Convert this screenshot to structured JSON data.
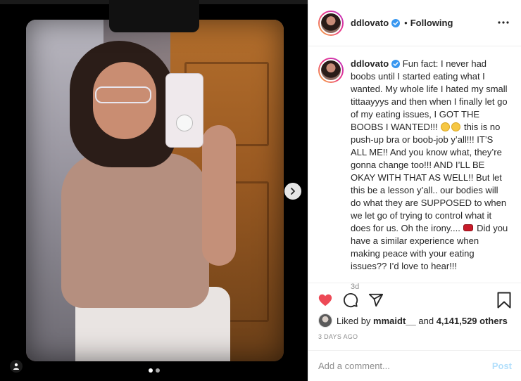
{
  "post": {
    "username": "ddlovato",
    "separator": "•",
    "follow_status": "Following",
    "more_icon": "more-horizontal-icon",
    "verified_color": "#3897f0"
  },
  "caption": {
    "username": "ddlovato",
    "part1": "Fun fact: I never had boobs until I started eating what I wanted. My whole life I hated my small tittaayyys and then when I finally let go of my eating issues, I GOT THE BOOBS I WANTED!!!",
    "part2": "this is no push-up bra or boob-job y’all!!! IT’S ALL ME!! And you know what, they’re gonna change too!!! AND I’LL BE OKAY WITH THAT AS WELL!! But let this be a lesson y’all.. our bodies will do what they are SUPPOSED to when we let go of trying to control what it does for us. Oh the irony....",
    "part3": "Did you have a similar experience when making peace with your eating issues?? I’d love to hear!!!",
    "emoji1": "grinning-sweat-emoji",
    "emoji2": "grinning-sweat-emoji",
    "emoji3": "lips-emoji",
    "time": "3d"
  },
  "actions": {
    "like_icon": "heart-filled-icon",
    "like_color": "#ed4956",
    "comment_icon": "comment-icon",
    "share_icon": "share-icon",
    "save_icon": "bookmark-icon"
  },
  "likes": {
    "prefix": "Liked by",
    "user": "mmaidt__",
    "conj": "and",
    "count": "4,141,529 others"
  },
  "timestamp": "3 DAYS AGO",
  "comment": {
    "placeholder": "Add a comment...",
    "post_label": "Post",
    "post_color": "#b2dffc"
  },
  "carousel": {
    "current": 1,
    "total": 2,
    "next_icon": "chevron-right-icon",
    "tag_icon": "user-tag-icon"
  }
}
